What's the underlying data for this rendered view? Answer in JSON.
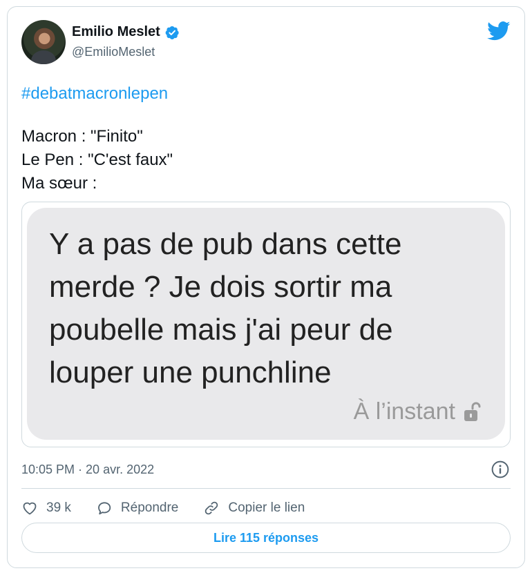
{
  "author": {
    "name": "Emilio Meslet",
    "handle": "@EmilioMeslet",
    "verified": true
  },
  "tweet": {
    "hashtag": "#debatmacronlepen",
    "lines": [
      "Macron : \"Finito\"",
      "Le Pen : \"C'est faux\"",
      "Ma sœur :"
    ]
  },
  "media": {
    "message_lines": [
      "Y a pas de pub dans cette",
      "merde ? Je dois sortir ma",
      "poubelle mais j'ai peur de",
      "louper une punchline"
    ],
    "timestamp": "À l’instant"
  },
  "meta": {
    "datetime": "10:05 PM · 20 avr. 2022"
  },
  "actions": {
    "likes": "39 k",
    "reply_label": "Répondre",
    "copy_link_label": "Copier le lien"
  },
  "replies_button": "Lire 115 réponses",
  "colors": {
    "accent": "#1d9bf0",
    "text": "#0f1419",
    "secondary": "#536471",
    "bubble": "#e9e9eb"
  },
  "icons": [
    "verified-badge-icon",
    "twitter-bird-icon",
    "lock-open-icon",
    "info-icon",
    "heart-icon",
    "reply-icon",
    "link-icon"
  ]
}
